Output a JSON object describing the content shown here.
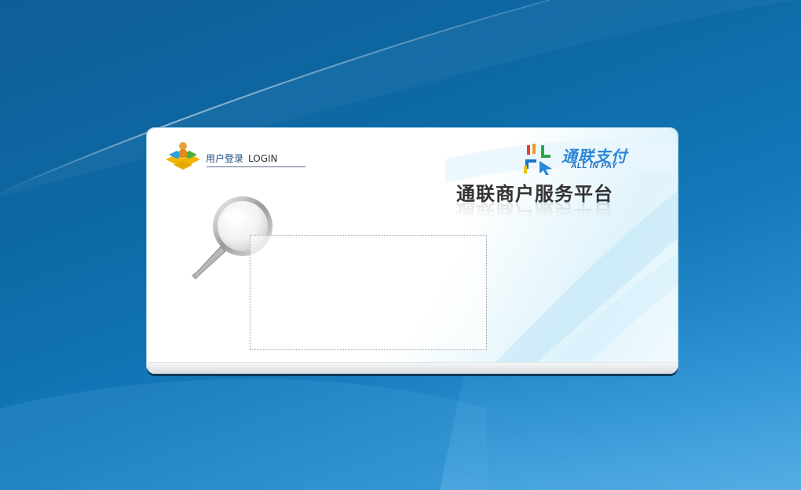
{
  "login_header": {
    "title_cn": "用户登录",
    "title_en": "LOGIN"
  },
  "brand": {
    "name_cn": "通联支付",
    "name_en": "ALL IN PAY"
  },
  "platform": {
    "title": "通联商户服务平台"
  },
  "colors": {
    "background": "#1170b0",
    "card": "#ffffff",
    "brand_blue": "#2a86d8",
    "title_text": "#333333",
    "login_title": "#1d4f86"
  },
  "icons": [
    "user-login-icon",
    "allinpay-logo-icon",
    "magnifier-icon"
  ]
}
